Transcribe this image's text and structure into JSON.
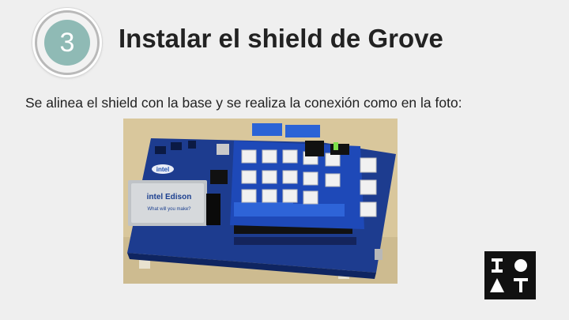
{
  "slide": {
    "step_number": "3",
    "title": "Instalar el shield de Grove",
    "description": "Se alinea el shield con la base y se realiza la conexión como en la foto:"
  },
  "photo": {
    "board_brand": "intel",
    "module_brand": "intel Edison",
    "module_tagline": "What will you make?"
  },
  "logo": {
    "icon": "iot-logo-icon"
  },
  "colors": {
    "background": "#efefef",
    "badge_fill": "#8fbab5",
    "title_text": "#222222"
  }
}
